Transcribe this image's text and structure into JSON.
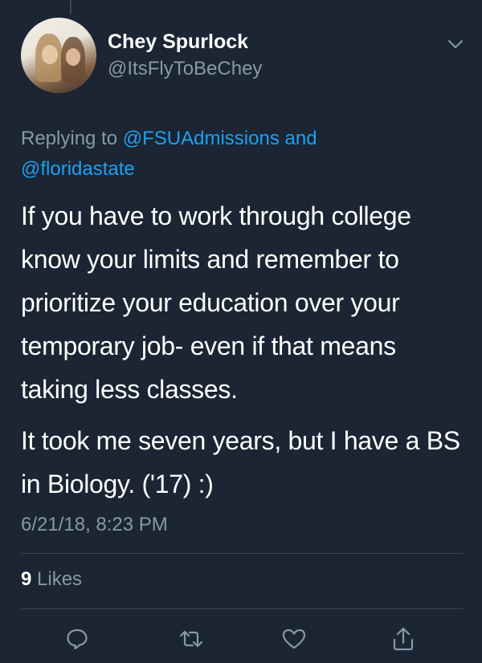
{
  "tweet": {
    "display_name": "Chey Spurlock",
    "handle": "@ItsFlyToBeChey",
    "replying_prefix": "Replying to ",
    "replying_mention_1": "@FSUAdmissions",
    "replying_and": " and",
    "replying_mention_2": "@floridastate",
    "paragraph_1": "If you have to work through college know your limits and remember to prioritize your education over your temporary job- even if that means taking less classes.",
    "paragraph_2": "It took me seven years, but I have a BS in Biology. ('17) :)",
    "timestamp": "6/21/18, 8:23 PM",
    "likes_count": "9",
    "likes_label": "Likes"
  },
  "icons": {
    "more": "chevron-down-icon",
    "reply": "reply-icon",
    "retweet": "retweet-icon",
    "like": "heart-icon",
    "share": "share-icon"
  },
  "colors": {
    "background": "#1b2533",
    "secondary_text": "#8899a6",
    "link": "#1da1f2",
    "divider": "#38444d"
  }
}
